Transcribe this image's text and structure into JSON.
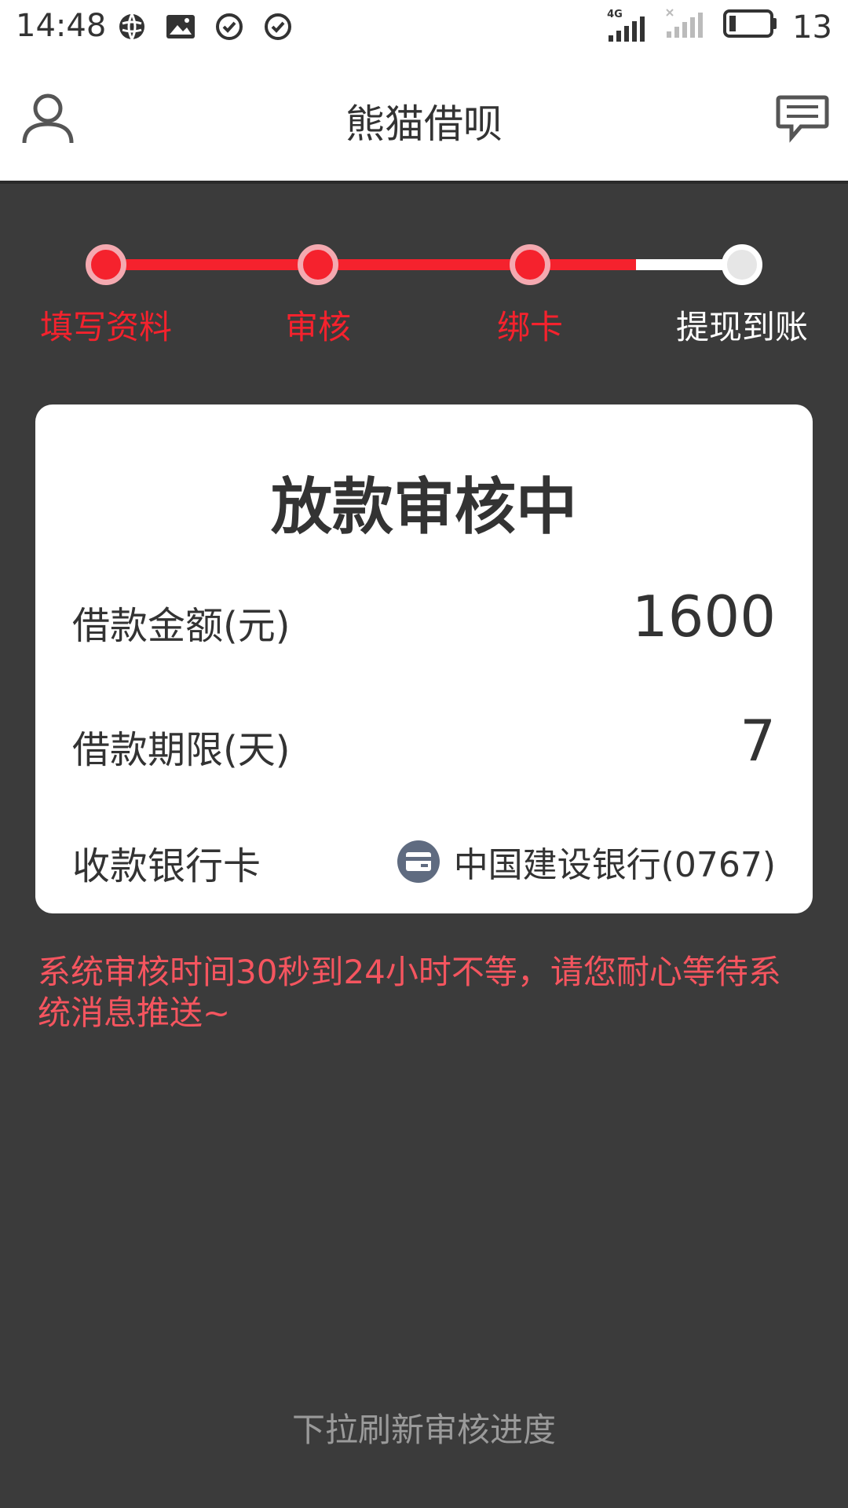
{
  "status_bar": {
    "time": "14:48",
    "network": "4G",
    "battery": "13",
    "icons": [
      "vpn-icon",
      "photo-icon",
      "check-circle-icon",
      "check-circle-icon",
      "signal-icon",
      "signal-no-sim-icon",
      "battery-icon"
    ]
  },
  "header": {
    "title": "熊猫借呗",
    "left_icon": "user-icon",
    "right_icon": "message-icon"
  },
  "progress": {
    "steps": [
      {
        "label": "填写资料",
        "done": true
      },
      {
        "label": "审核",
        "done": true
      },
      {
        "label": "绑卡",
        "done": true
      },
      {
        "label": "提现到账",
        "done": false
      }
    ],
    "active_color": "#f5222d"
  },
  "card": {
    "title": "放款审核中",
    "amount_label": "借款金额(元)",
    "amount_value": "1600",
    "term_label": "借款期限(天)",
    "term_value": "7",
    "bank_label": "收款银行卡",
    "bank_value": "中国建设银行(0767)",
    "bank_icon": "bank-card-icon"
  },
  "notice": "系统审核时间30秒到24小时不等，请您耐心等待系统消息推送~",
  "pull_hint": "下拉刷新审核进度"
}
